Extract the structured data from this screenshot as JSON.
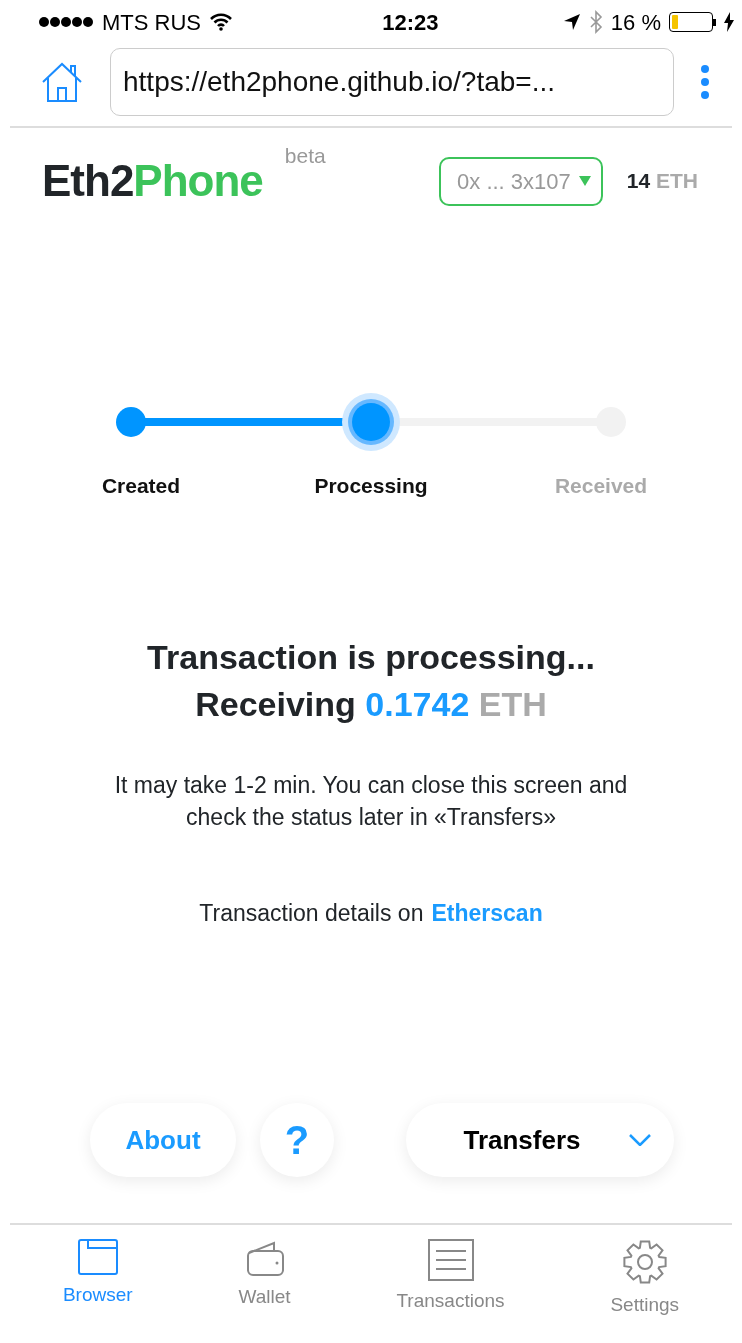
{
  "status_bar": {
    "carrier": "MTS RUS",
    "time": "12:23",
    "battery": "16 %"
  },
  "browser": {
    "url": "https://eth2phone.github.io/?tab=..."
  },
  "header": {
    "logo_dark": "Eth2",
    "logo_green": "Phone",
    "tag": "beta",
    "account": "0x ... 3x107",
    "balance_value": "14",
    "balance_unit": "ETH"
  },
  "steps": [
    {
      "label": "Created",
      "kind": "done"
    },
    {
      "label": "Processing",
      "kind": "current"
    },
    {
      "label": "Received",
      "kind": "pending"
    }
  ],
  "message": {
    "title": "Transaction is processing...",
    "receiving_label": "Receiving",
    "amount": "0.1742",
    "unit": "ETH",
    "note": "It may take 1-2 min. You can close this screen and check the status later in «Transfers»",
    "details_text": "Transaction details on",
    "details_link": "Etherscan"
  },
  "actions": {
    "about": "About",
    "help": "?",
    "transfers": "Transfers"
  },
  "tabs": [
    {
      "label": "Browser",
      "kind": "browser",
      "selected": true
    },
    {
      "label": "Wallet",
      "kind": "wallet",
      "selected": false
    },
    {
      "label": "Transactions",
      "kind": "transactions",
      "selected": false
    },
    {
      "label": "Settings",
      "kind": "settings",
      "selected": false
    }
  ]
}
